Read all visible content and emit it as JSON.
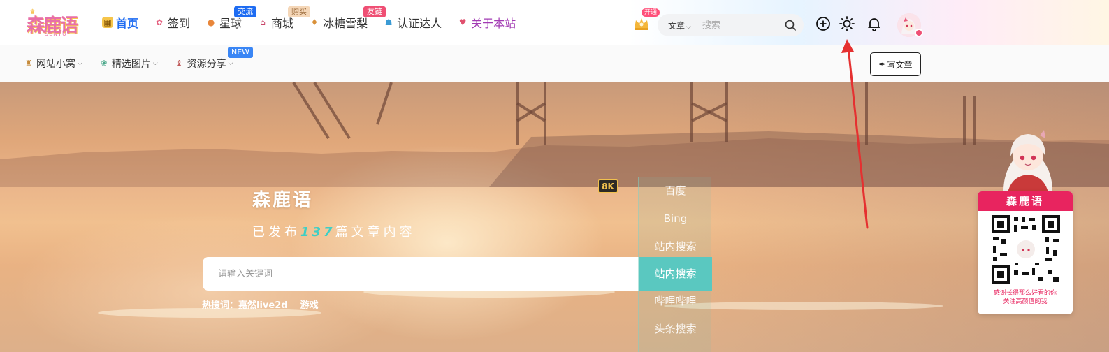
{
  "header": {
    "logo": {
      "text": "森鹿语",
      "sub": "SENYU"
    },
    "nav": [
      {
        "label": "首页",
        "icon": "home-icon"
      },
      {
        "label": "签到",
        "icon": "checkin-icon"
      },
      {
        "label": "星球",
        "icon": "planet-icon",
        "badge": "交流"
      },
      {
        "label": "商城",
        "icon": "shop-icon",
        "badge": "购买"
      },
      {
        "label": "冰糖雪梨",
        "icon": "pear-icon",
        "badge": "友链"
      },
      {
        "label": "认证达人",
        "icon": "verified-icon"
      },
      {
        "label": "关于本站",
        "icon": "about-icon"
      }
    ],
    "vip_badge": "开通",
    "search": {
      "type": "文章",
      "placeholder": "搜索"
    }
  },
  "subnav": {
    "items": [
      {
        "label": "网站小窝",
        "icon": "house-icon"
      },
      {
        "label": "精选图片",
        "icon": "image-icon"
      },
      {
        "label": "资源分享",
        "icon": "resource-icon"
      }
    ],
    "new_badge": "NEW",
    "write_label": "写文章"
  },
  "hero": {
    "title": "森鹿语",
    "subtitle_prefix": "已发布",
    "count": "137",
    "subtitle_suffix": "篇文章内容",
    "badge": "8K",
    "search_placeholder": "请输入关键词",
    "engines": [
      "百度",
      "Bing",
      "站内搜索",
      "站内搜索",
      "哔哩哔哩",
      "头条搜索"
    ],
    "active_engine_index": 3,
    "hot_label": "热搜词：",
    "hot_words": [
      "嘉然live2d",
      "游戏"
    ]
  },
  "qr_card": {
    "title": "森鹿语",
    "caption_line1": "感谢长得那么好看的你",
    "caption_line2": "关注高颜值的我"
  },
  "colors": {
    "accent": "#1e6cf2",
    "pink": "#e8245f",
    "teal": "#5ac8c0",
    "arrow": "#e53030"
  }
}
